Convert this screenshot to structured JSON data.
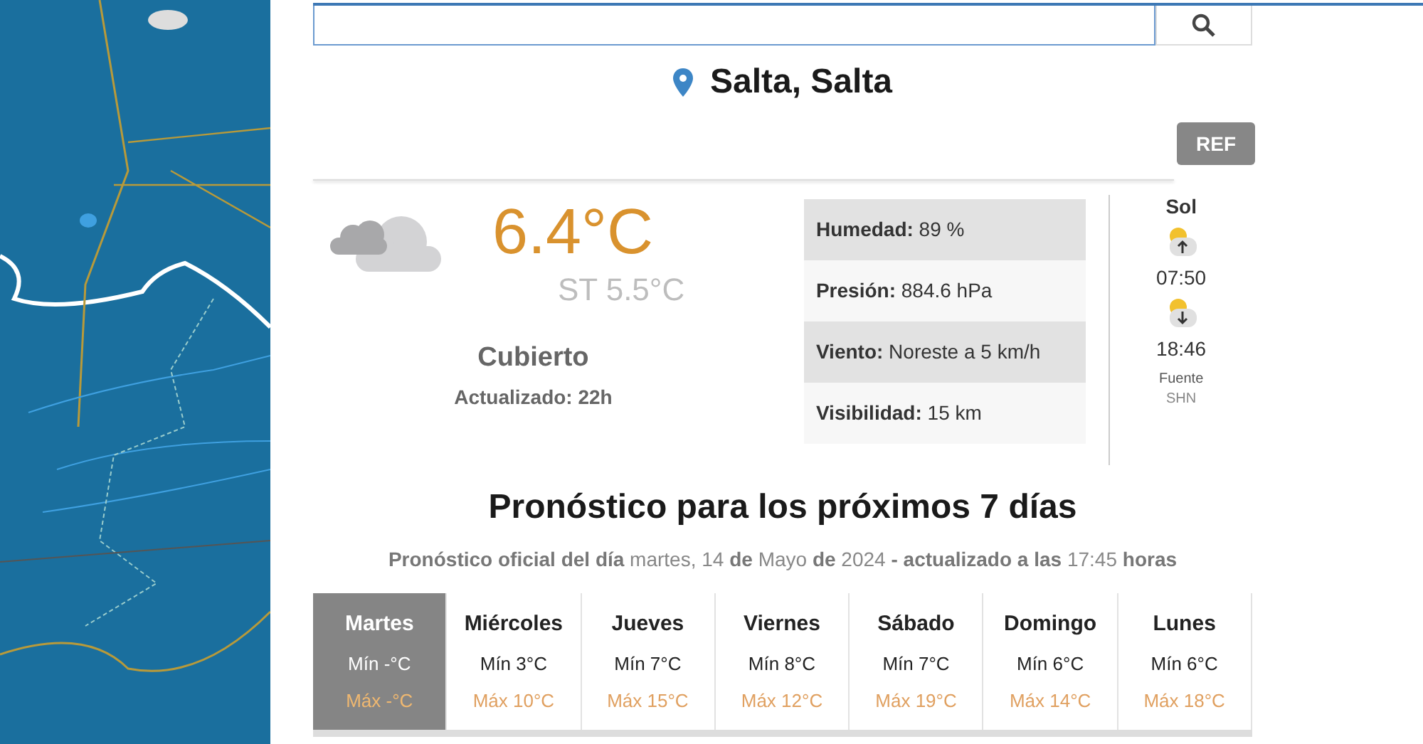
{
  "location": {
    "title": "Salta, Salta"
  },
  "ref_button": "REF",
  "current": {
    "temperature": "6.4°C",
    "feels_like": "ST 5.5°C",
    "condition": "Cubierto",
    "updated": "Actualizado: 22h",
    "stats": [
      "**Humedad:** 89 %",
      "**Presión:** 884.6 hPa",
      "**Viento:** Noreste a 5 km/h",
      "**Visibilidad:** 15 km"
    ]
  },
  "sun": {
    "title": "Sol",
    "sunrise": "07:50",
    "sunset": "18:46",
    "source_label": "Fuente",
    "source": "SHN"
  },
  "forecast": {
    "title": "Pronóstico para los próximos 7 días",
    "subtitle": "**Pronóstico oficial del día** martes, 14 **de** Mayo **de** 2024 **- actualizado a las** 17:45 **horas**",
    "days": [
      {
        "day": "Martes",
        "min": "Mín -°C",
        "max": "Máx -°C",
        "selected": true
      },
      {
        "day": "Miércoles",
        "min": "Mín 3°C",
        "max": "Máx 10°C",
        "selected": false
      },
      {
        "day": "Jueves",
        "min": "Mín 7°C",
        "max": "Máx 15°C",
        "selected": false
      },
      {
        "day": "Viernes",
        "min": "Mín 8°C",
        "max": "Máx 12°C",
        "selected": false
      },
      {
        "day": "Sábado",
        "min": "Mín 7°C",
        "max": "Máx 19°C",
        "selected": false
      },
      {
        "day": "Domingo",
        "min": "Mín 6°C",
        "max": "Máx 14°C",
        "selected": false
      },
      {
        "day": "Lunes",
        "min": "Mín 6°C",
        "max": "Máx 18°C",
        "selected": false
      }
    ]
  }
}
